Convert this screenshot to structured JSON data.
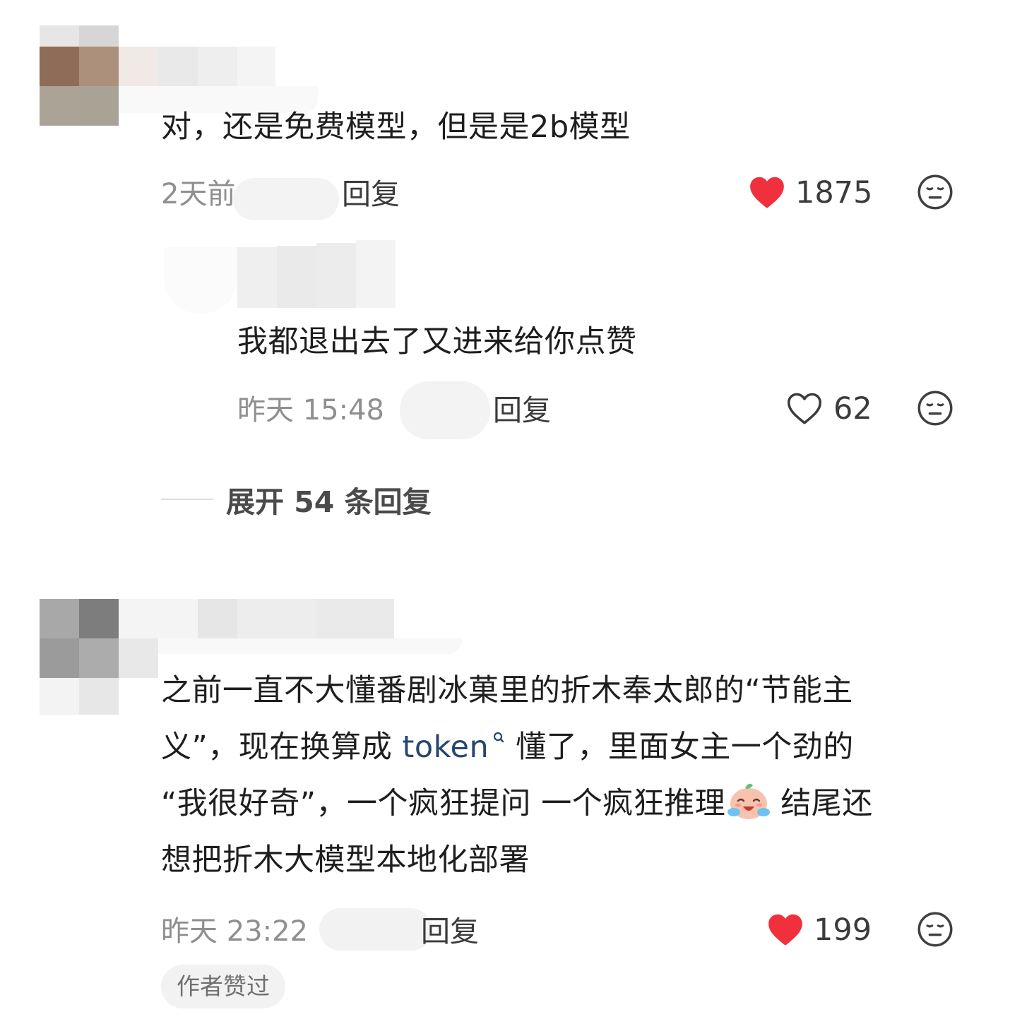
{
  "comments": [
    {
      "text": "对，还是免费模型，但是是2b模型",
      "time": "2天前",
      "reply_label": "回复",
      "likes": "1875",
      "liked": true,
      "reply": {
        "text": "我都退出去了又进来给你点赞",
        "time": "昨天 15:48",
        "reply_label": "回复",
        "likes": "62",
        "liked": false
      },
      "expand_label": "展开 54 条回复"
    },
    {
      "text_parts": {
        "line1": "之前一直不大懂番剧冰菓里的折木奉太郎的“节能主",
        "line2_before": "义”，现在换算成 ",
        "line2_link": "token",
        "line2_after": "懂了，里面女主一个劲的",
        "line3_before": "“我很好奇”，一个疯狂提问 一个疯狂推理",
        "line3_after": "结尾还",
        "line4": "想把折木大模型本地化部署"
      },
      "time": "昨天 23:22",
      "reply_label": "回复",
      "likes": "199",
      "liked": true,
      "author_badge": "作者赞过"
    }
  ],
  "icons": {
    "heart_filled": "heart-filled-icon",
    "heart_outline": "heart-outline-icon",
    "dislike": "dislike-face-icon",
    "search": "search-icon",
    "emoji": "crying-laughing-emoji"
  },
  "colors": {
    "heart": "#f0303c",
    "link": "#27466f",
    "meta": "#8f8f8f"
  }
}
